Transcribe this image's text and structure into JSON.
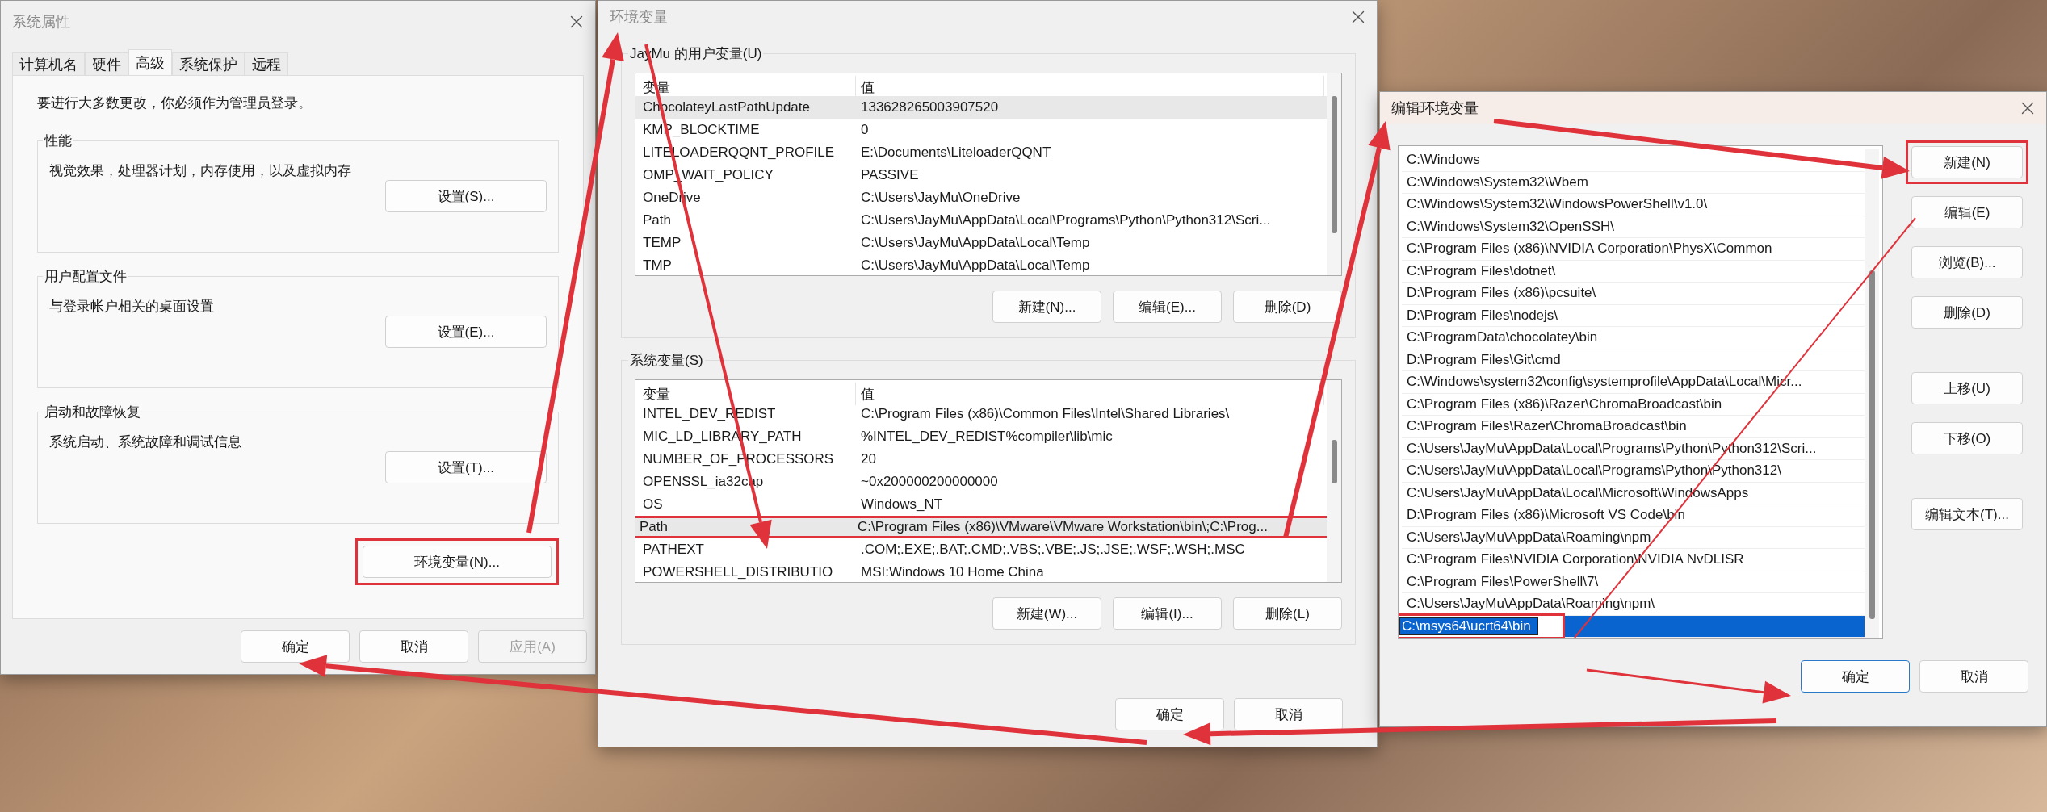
{
  "system_properties": {
    "title": "系统属性",
    "tabs": [
      {
        "label": "计算机名",
        "selected": false
      },
      {
        "label": "硬件",
        "selected": false
      },
      {
        "label": "高级",
        "selected": true
      },
      {
        "label": "系统保护",
        "selected": false
      },
      {
        "label": "远程",
        "selected": false
      }
    ],
    "notice": "要进行大多数更改，你必须作为管理员登录。",
    "groups": [
      {
        "title": "性能",
        "description": "视觉效果，处理器计划，内存使用，以及虚拟内存",
        "button": "设置(S)..."
      },
      {
        "title": "用户配置文件",
        "description": "与登录帐户相关的桌面设置",
        "button": "设置(E)..."
      },
      {
        "title": "启动和故障恢复",
        "description": "系统启动、系统故障和调试信息",
        "button": "设置(T)..."
      }
    ],
    "env_button": {
      "label": "环境变量(N)...",
      "highlighted": true
    },
    "footer": [
      {
        "label": "确定",
        "disabled": false
      },
      {
        "label": "取消",
        "disabled": false
      },
      {
        "label": "应用(A)",
        "disabled": true
      }
    ]
  },
  "environment_variables": {
    "title": "环境变量",
    "sections": [
      {
        "title": "JayMu 的用户变量(U)",
        "columns": [
          "变量",
          "值"
        ],
        "rows": [
          {
            "name": "ChocolateyLastPathUpdate",
            "value": "133628265003907520",
            "selected": true,
            "highlighted": false
          },
          {
            "name": "KMP_BLOCKTIME",
            "value": "0",
            "selected": false,
            "highlighted": false
          },
          {
            "name": "LITELOADERQQNT_PROFILE",
            "value": "E:\\Documents\\LiteloaderQQNT",
            "selected": false,
            "highlighted": false
          },
          {
            "name": "OMP_WAIT_POLICY",
            "value": "PASSIVE",
            "selected": false,
            "highlighted": false
          },
          {
            "name": "OneDrive",
            "value": "C:\\Users\\JayMu\\OneDrive",
            "selected": false,
            "highlighted": false
          },
          {
            "name": "Path",
            "value": "C:\\Users\\JayMu\\AppData\\Local\\Programs\\Python\\Python312\\Scri...",
            "selected": false,
            "highlighted": false
          },
          {
            "name": "TEMP",
            "value": "C:\\Users\\JayMu\\AppData\\Local\\Temp",
            "selected": false,
            "highlighted": false
          },
          {
            "name": "TMP",
            "value": "C:\\Users\\JayMu\\AppData\\Local\\Temp",
            "selected": false,
            "highlighted": false
          }
        ],
        "buttons": [
          "新建(N)...",
          "编辑(E)...",
          "删除(D)"
        ]
      },
      {
        "title": "系统变量(S)",
        "columns": [
          "变量",
          "值"
        ],
        "rows": [
          {
            "name": "INTEL_DEV_REDIST",
            "value": "C:\\Program Files (x86)\\Common Files\\Intel\\Shared Libraries\\",
            "selected": false,
            "highlighted": false
          },
          {
            "name": "MIC_LD_LIBRARY_PATH",
            "value": "%INTEL_DEV_REDIST%compiler\\lib\\mic",
            "selected": false,
            "highlighted": false
          },
          {
            "name": "NUMBER_OF_PROCESSORS",
            "value": "20",
            "selected": false,
            "highlighted": false
          },
          {
            "name": "OPENSSL_ia32cap",
            "value": "~0x200000200000000",
            "selected": false,
            "highlighted": false
          },
          {
            "name": "OS",
            "value": "Windows_NT",
            "selected": false,
            "highlighted": false
          },
          {
            "name": "Path",
            "value": "C:\\Program Files (x86)\\VMware\\VMware Workstation\\bin\\;C:\\Prog...",
            "selected": true,
            "highlighted": true
          },
          {
            "name": "PATHEXT",
            "value": ".COM;.EXE;.BAT;.CMD;.VBS;.VBE;.JS;.JSE;.WSF;.WSH;.MSC",
            "selected": false,
            "highlighted": false
          },
          {
            "name": "POWERSHELL_DISTRIBUTIO",
            "value": "MSI:Windows 10 Home China",
            "selected": false,
            "highlighted": false
          }
        ],
        "buttons": [
          "新建(W)...",
          "编辑(I)...",
          "删除(L)"
        ]
      }
    ],
    "footer": [
      "确定",
      "取消"
    ]
  },
  "edit_variable": {
    "title": "编辑环境变量",
    "entries": [
      {
        "text": "C:\\Windows",
        "selected": false,
        "editing": false
      },
      {
        "text": "C:\\Windows\\System32\\Wbem",
        "selected": false,
        "editing": false
      },
      {
        "text": "C:\\Windows\\System32\\WindowsPowerShell\\v1.0\\",
        "selected": false,
        "editing": false
      },
      {
        "text": "C:\\Windows\\System32\\OpenSSH\\",
        "selected": false,
        "editing": false
      },
      {
        "text": "C:\\Program Files (x86)\\NVIDIA Corporation\\PhysX\\Common",
        "selected": false,
        "editing": false
      },
      {
        "text": "C:\\Program Files\\dotnet\\",
        "selected": false,
        "editing": false
      },
      {
        "text": "D:\\Program Files (x86)\\pcsuite\\",
        "selected": false,
        "editing": false
      },
      {
        "text": "D:\\Program Files\\nodejs\\",
        "selected": false,
        "editing": false
      },
      {
        "text": "C:\\ProgramData\\chocolatey\\bin",
        "selected": false,
        "editing": false
      },
      {
        "text": "D:\\Program Files\\Git\\cmd",
        "selected": false,
        "editing": false
      },
      {
        "text": "C:\\Windows\\system32\\config\\systemprofile\\AppData\\Local\\Micr...",
        "selected": false,
        "editing": false
      },
      {
        "text": "C:\\Program Files (x86)\\Razer\\ChromaBroadcast\\bin",
        "selected": false,
        "editing": false
      },
      {
        "text": "C:\\Program Files\\Razer\\ChromaBroadcast\\bin",
        "selected": false,
        "editing": false
      },
      {
        "text": "C:\\Users\\JayMu\\AppData\\Local\\Programs\\Python\\Python312\\Scri...",
        "selected": false,
        "editing": false
      },
      {
        "text": "C:\\Users\\JayMu\\AppData\\Local\\Programs\\Python\\Python312\\",
        "selected": false,
        "editing": false
      },
      {
        "text": "C:\\Users\\JayMu\\AppData\\Local\\Microsoft\\WindowsApps",
        "selected": false,
        "editing": false
      },
      {
        "text": "D:\\Program Files (x86)\\Microsoft VS Code\\bin",
        "selected": false,
        "editing": false
      },
      {
        "text": "C:\\Users\\JayMu\\AppData\\Roaming\\npm",
        "selected": false,
        "editing": false
      },
      {
        "text": "C:\\Program Files\\NVIDIA Corporation\\NVIDIA NvDLISR",
        "selected": false,
        "editing": false
      },
      {
        "text": "C:\\Program Files\\PowerShell\\7\\",
        "selected": false,
        "editing": false
      },
      {
        "text": "C:\\Users\\JayMu\\AppData\\Roaming\\npm\\",
        "selected": false,
        "editing": false
      },
      {
        "text": "C:\\msys64\\ucrt64\\bin",
        "selected": true,
        "editing": true
      }
    ],
    "buttons": [
      {
        "label": "新建(N)",
        "highlighted": true,
        "gap_before": false
      },
      {
        "label": "编辑(E)",
        "highlighted": false,
        "gap_before": false
      },
      {
        "label": "浏览(B)...",
        "highlighted": false,
        "gap_before": false
      },
      {
        "label": "删除(D)",
        "highlighted": false,
        "gap_before": false
      },
      {
        "label": "上移(U)",
        "highlighted": false,
        "gap_before": true
      },
      {
        "label": "下移(O)",
        "highlighted": false,
        "gap_before": false
      },
      {
        "label": "编辑文本(T)...",
        "highlighted": false,
        "gap_before": true
      }
    ],
    "footer": [
      {
        "label": "确定",
        "default": true
      },
      {
        "label": "取消",
        "default": false
      }
    ]
  }
}
